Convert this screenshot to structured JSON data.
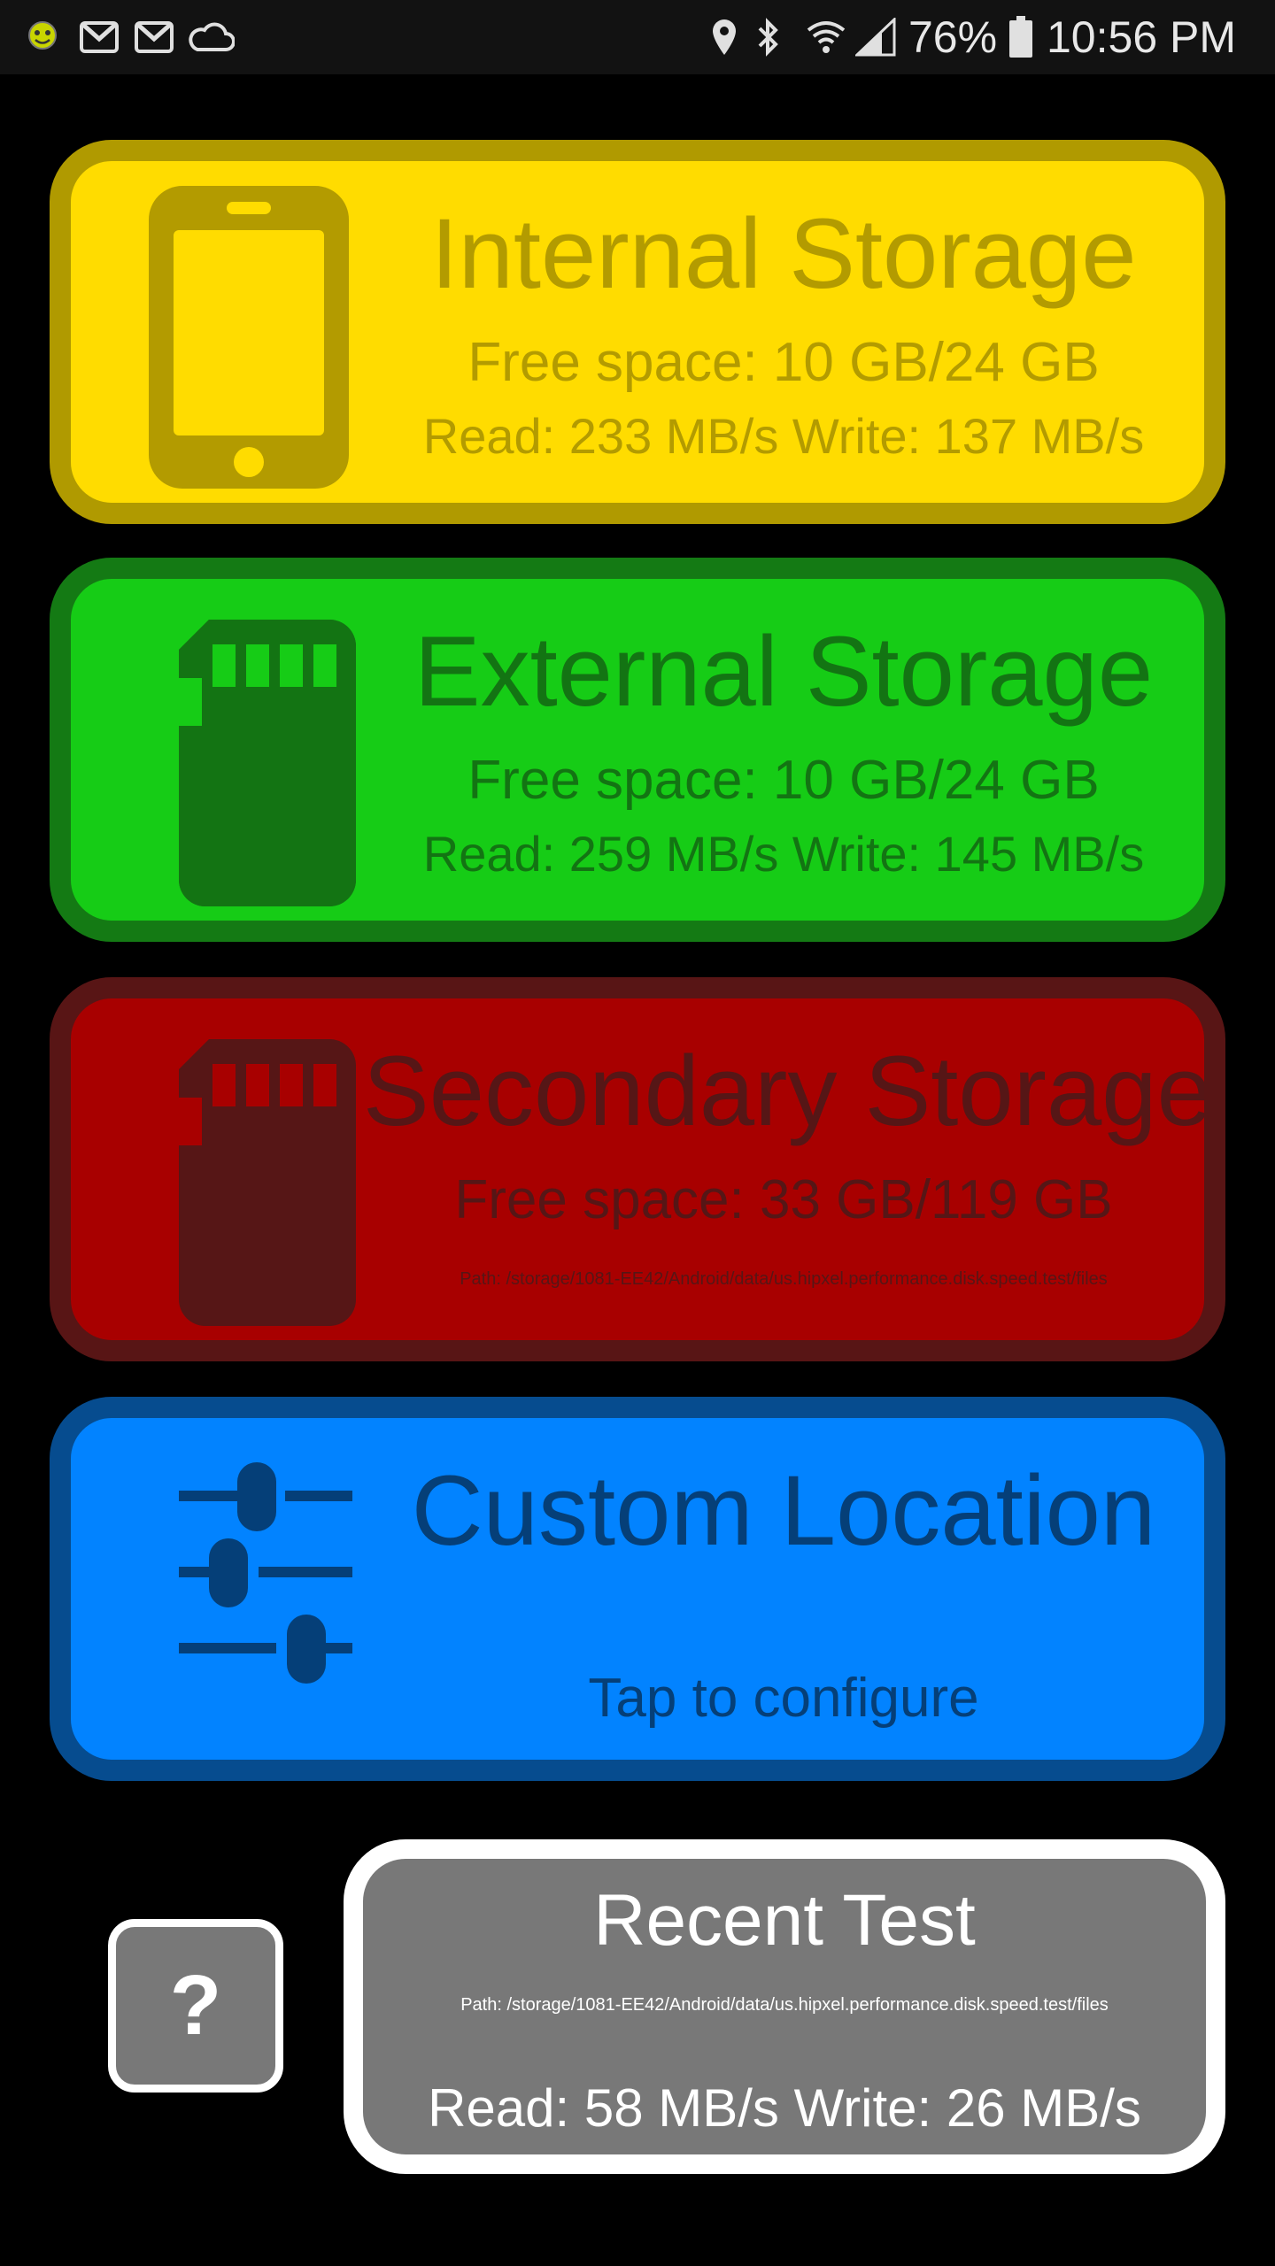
{
  "status_bar": {
    "battery": "76%",
    "time": "10:56 PM",
    "left_icons": [
      "app-face-icon",
      "gmail-icon",
      "gmail-icon",
      "cloud-icon"
    ],
    "right_icons": [
      "location-icon",
      "bluetooth-icon",
      "wifi-icon",
      "signal-icon",
      "battery-icon"
    ]
  },
  "cards": {
    "internal": {
      "title": "Internal Storage",
      "free_space": "Free space: 10 GB/24 GB",
      "speed": "Read: 233 MB/s Write: 137 MB/s",
      "icon": "phone-icon",
      "color": "#ffdc00"
    },
    "external": {
      "title": "External Storage",
      "free_space": "Free space: 10 GB/24 GB",
      "speed": "Read: 259 MB/s Write: 145 MB/s",
      "icon": "sd-card-icon",
      "color": "#16cc16"
    },
    "secondary": {
      "title": "Secondary Storage",
      "free_space": "Free space: 33 GB/119 GB",
      "path": "Path: /storage/1081-EE42/Android/data/us.hipxel.performance.disk.speed.test/files",
      "icon": "sd-card-icon",
      "color": "#a80000"
    },
    "custom": {
      "title": "Custom Location",
      "subtitle": "Tap to configure",
      "icon": "sliders-icon",
      "color": "#0283ff"
    }
  },
  "help": {
    "label": "?"
  },
  "recent_test": {
    "title": "Recent Test",
    "path": "Path: /storage/1081-EE42/Android/data/us.hipxel.performance.disk.speed.test/files",
    "speed": "Read: 58 MB/s Write: 26 MB/s"
  }
}
